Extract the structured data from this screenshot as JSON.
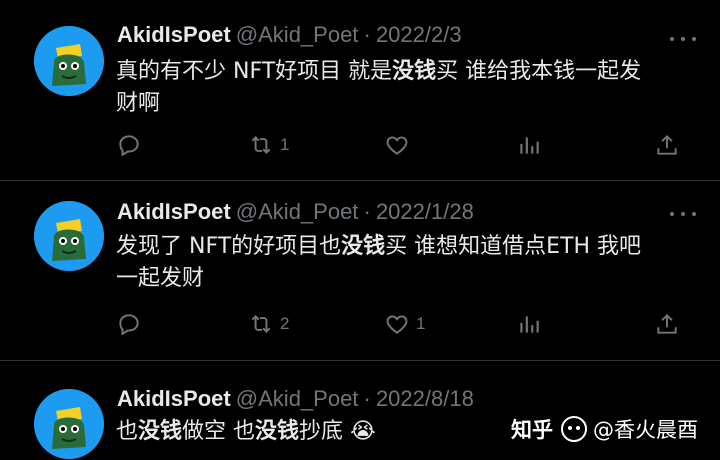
{
  "tweets": [
    {
      "name": "AkidIsPoet",
      "handle": "@Akid_Poet",
      "sep": "·",
      "date": "2022/2/3",
      "line1_a": "真的有不少 NFT好项目 就是",
      "line1_b": "没钱",
      "line1_c": "买 谁给我本钱一起发",
      "line2": "财啊",
      "retweets": "1",
      "likes": ""
    },
    {
      "name": "AkidIsPoet",
      "handle": "@Akid_Poet",
      "sep": "·",
      "date": "2022/1/28",
      "line1_a": "发现了 NFT的好项目也",
      "line1_b": "没钱",
      "line1_c": "买 谁想知道借点ETH 我吧",
      "line2": "一起发财",
      "retweets": "2",
      "likes": "1"
    },
    {
      "name": "AkidIsPoet",
      "handle": "@Akid_Poet",
      "sep": "·",
      "date": "2022/8/18",
      "line1_a": "也",
      "line1_b": "没钱",
      "line1_c": "做空 也",
      "line1_d": "没钱",
      "line1_e": "抄底",
      "emoji": "😭"
    }
  ],
  "watermark": {
    "site": "知乎",
    "author": "@香火晨酉"
  },
  "colors": {
    "background": "#000000",
    "text": "#e7e9ea",
    "secondary": "#71767b",
    "avatar_bg": "#1d9bf0"
  },
  "icons": [
    "reply-icon",
    "retweet-icon",
    "like-icon",
    "views-icon",
    "share-icon",
    "more-icon"
  ]
}
